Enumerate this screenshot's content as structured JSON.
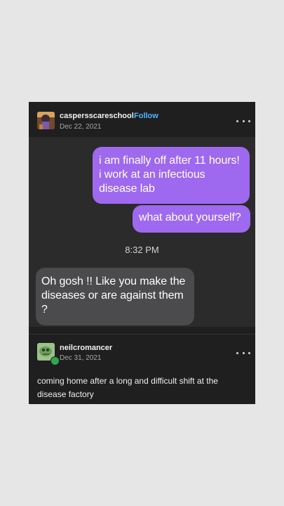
{
  "post": {
    "username": "caspersscareschool",
    "follow_label": "Follow",
    "date": "Dec 22, 2021"
  },
  "screenshot": {
    "message_1": "i am finally off after 11 hours! i work at an infectious disease lab",
    "message_2": "what about yourself?",
    "timestamp": "8:32 PM",
    "reply": "Oh gosh !! Like you make the diseases or are against them ?"
  },
  "reblog": {
    "username": "neilcromancer",
    "date": "Dec 31, 2021",
    "caption": "coming home after a long and difficult shift at the disease factory"
  },
  "colors": {
    "background": "#e6e6e6",
    "card": "#1f1f20",
    "outgoing_bubble": "#9e69ef",
    "incoming_bubble": "#4b4b4d",
    "follow": "#4fb6ff"
  }
}
